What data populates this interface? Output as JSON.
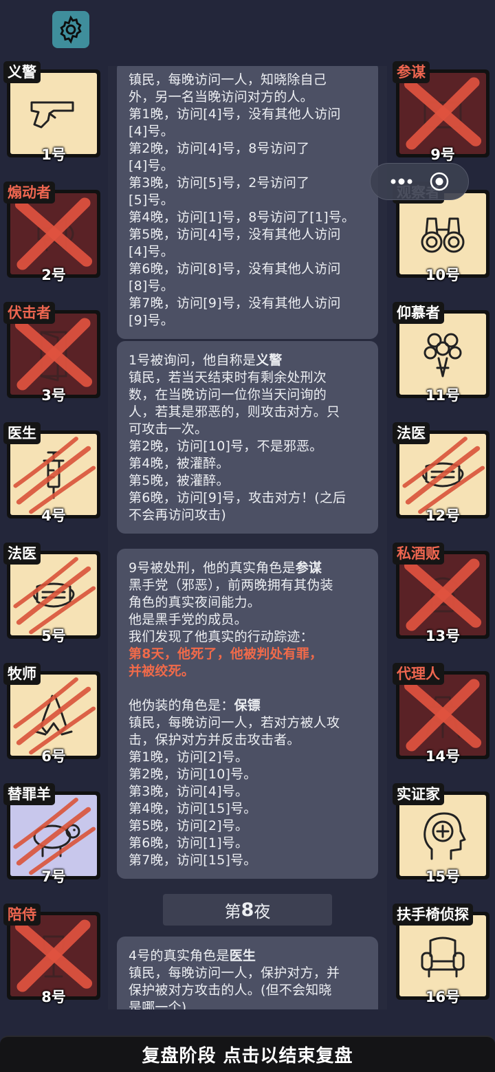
{
  "messages": [
    {
      "lines": [
        "镇民，每晚访问一人，知晓除自己",
        "外，另一名当晚访问对方的人。",
        "第1晚，访问[4]号，没有其他人访问",
        "[4]号。",
        "第2晚，访问[4]号，8号访问了",
        "[4]号。",
        "第3晚，访问[5]号，2号访问了",
        "[5]号。",
        "第4晚，访问[1]号，8号访问了[1]号。",
        "第5晚，访问[4]号，没有其他人访问",
        "[4]号。",
        "第6晚，访问[8]号，没有其他人访问",
        "[8]号。",
        "第7晚，访问[9]号，没有其他人访问",
        "[9]号。"
      ]
    },
    {
      "title_prefix": "1号被询问，他自称是",
      "title_role": "义警",
      "lines": [
        "镇民，若当天结束时有剩余处刑次",
        "数，在当晚访问一位你当天问询的",
        "人，若其是邪恶的，则攻击对方。只",
        "可攻击一次。",
        "第2晚，访问[10]号，不是邪恶。",
        "第4晚，被灌醉。",
        "第5晚，被灌醉。",
        "第6晚，访问[9]号，攻击对方！(之后",
        "不会再访问攻击)"
      ]
    },
    {
      "title_prefix": "9号被处刑，他的真实角色是",
      "title_role": "参谋",
      "lines": [
        "黑手党（邪恶），前两晚拥有其伪装",
        "角色的真实夜间能力。",
        "他是黑手党的成员。",
        "我们发现了他真实的行动踪迹："
      ],
      "red_lines": [
        "第8天，他死了，他被判处有罪，",
        "并被绞死。"
      ],
      "disguise_prefix": "他伪装的角色是：",
      "disguise_role": "保镖",
      "lines2": [
        "镇民，每晚访问一人，若对方被人攻",
        "击，保护对方并反击攻击者。",
        "第1晚，访问[2]号。",
        "第2晚，访问[10]号。",
        "第3晚，访问[4]号。",
        "第4晚，访问[15]号。",
        "第5晚，访问[2]号。",
        "第6晚，访问[1]号。",
        "第7晚，访问[15]号。"
      ]
    },
    {
      "title_prefix": "4号的真实角色是",
      "title_role": "医生",
      "lines": [
        "镇民，每晚访问一人，保护对方，并",
        "保护被对方攻击的人。(但不会知晓",
        "是哪一个)"
      ]
    }
  ],
  "night_label": {
    "prefix": "第",
    "num": "8",
    "suffix": "夜"
  },
  "left_players": [
    {
      "role": "义警",
      "num": "1号",
      "icon": "pistol-icon",
      "state": "alive"
    },
    {
      "role": "煽动者",
      "num": "2号",
      "icon": "megaphone-icon",
      "state": "dead"
    },
    {
      "role": "伏击者",
      "num": "3号",
      "icon": "door-icon",
      "state": "dead"
    },
    {
      "role": "医生",
      "num": "4号",
      "icon": "syringe-icon",
      "state": "clawed"
    },
    {
      "role": "法医",
      "num": "5号",
      "icon": "mask-icon",
      "state": "clawed"
    },
    {
      "role": "牧师",
      "num": "6号",
      "icon": "praying-hands-icon",
      "state": "clawed"
    },
    {
      "role": "替罪羊",
      "num": "7号",
      "icon": "sheep-icon",
      "state": "clawed"
    },
    {
      "role": "陪侍",
      "num": "8号",
      "icon": "wine-glass-icon",
      "state": "dead"
    }
  ],
  "right_players": [
    {
      "role": "参谋",
      "num": "9号",
      "icon": "envelope-icon",
      "state": "dead"
    },
    {
      "role": "观察者",
      "num": "10号",
      "icon": "binoculars-icon",
      "state": "alive"
    },
    {
      "role": "仰慕者",
      "num": "11号",
      "icon": "bouquet-icon",
      "state": "alive"
    },
    {
      "role": "法医",
      "num": "12号",
      "icon": "mask-icon",
      "state": "clawed"
    },
    {
      "role": "私酒贩",
      "num": "13号",
      "icon": "bootlegger-icon",
      "state": "dead"
    },
    {
      "role": "代理人",
      "num": "14号",
      "icon": "agent-icon",
      "state": "dead"
    },
    {
      "role": "实证家",
      "num": "15号",
      "icon": "head-plus-icon",
      "state": "alive"
    },
    {
      "role": "扶手椅侦探",
      "num": "16号",
      "icon": "armchair-icon",
      "state": "alive"
    }
  ],
  "bottom_bar": "复盘阶段 点击以结束复盘",
  "colors": {
    "background": "#23263a",
    "message_bubble": "#4c5064",
    "highlight_red": "#f06a4a",
    "card_alive": "#f6e2b5",
    "card_dead": "#5a2226",
    "card_scapegoat": "#c8c7ec",
    "cross_red": "#e0533f"
  }
}
